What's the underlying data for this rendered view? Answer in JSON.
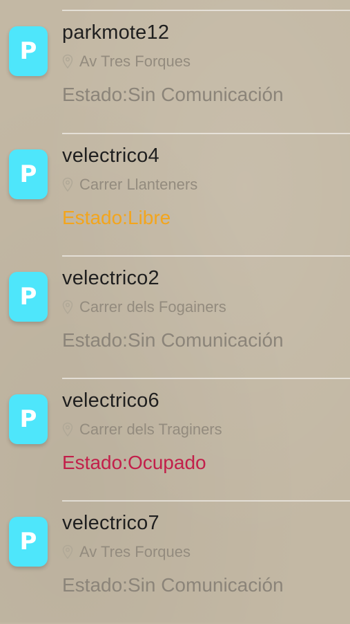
{
  "colors": {
    "background": "#c3b8a4",
    "icon_bg": "#4ee6fb",
    "status_sin": "#8b8479",
    "status_libre": "#f3a51c",
    "status_ocupado": "#c21f4a"
  },
  "icon_letter": "P",
  "items": [
    {
      "name": "parkmote12",
      "address": "Av Tres Forques",
      "status": "Estado:Sin Comunicación",
      "status_color": "#8b8479"
    },
    {
      "name": "velectrico4",
      "address": "Carrer Llanteners",
      "status": "Estado:Libre",
      "status_color": "#f3a51c"
    },
    {
      "name": "velectrico2",
      "address": "Carrer dels Fogainers",
      "status": "Estado:Sin Comunicación",
      "status_color": "#8b8479"
    },
    {
      "name": "velectrico6",
      "address": "Carrer dels Traginers",
      "status": "Estado:Ocupado",
      "status_color": "#c21f4a"
    },
    {
      "name": "velectrico7",
      "address": "Av Tres Forques",
      "status": "Estado:Sin Comunicación",
      "status_color": "#8b8479"
    }
  ]
}
